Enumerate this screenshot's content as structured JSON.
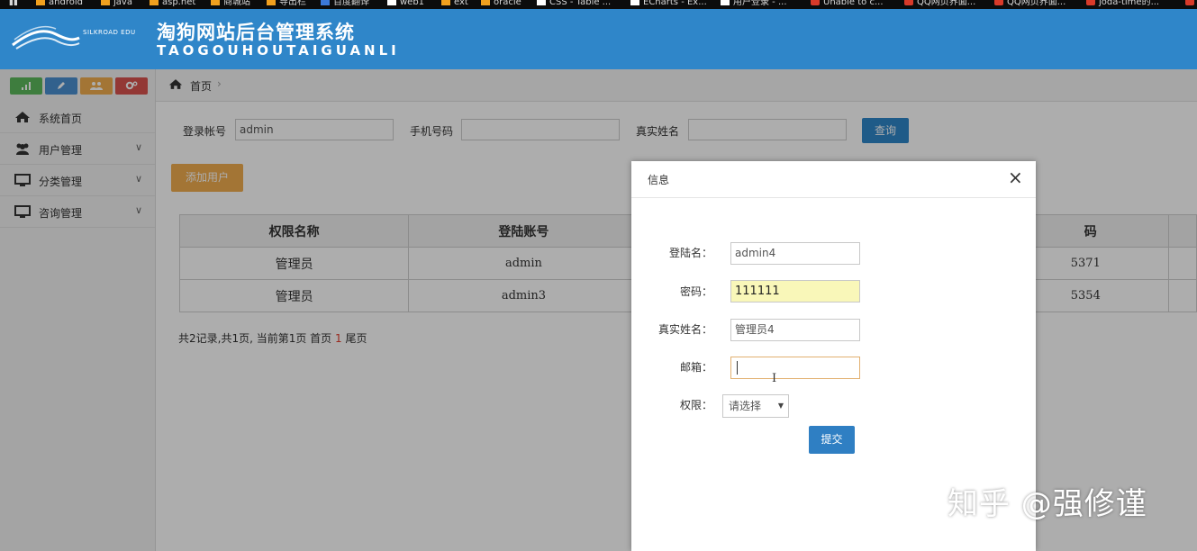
{
  "bookmarks": [
    {
      "label": "android",
      "icon": "folder-icon"
    },
    {
      "label": "java",
      "icon": "folder-icon"
    },
    {
      "label": "asp.net",
      "icon": "folder-icon"
    },
    {
      "label": "商城站",
      "icon": "folder-icon"
    },
    {
      "label": "导出栏",
      "icon": "folder-icon"
    },
    {
      "label": "百度翻译",
      "icon": "translate-icon"
    },
    {
      "label": "web1",
      "icon": "page-icon"
    },
    {
      "label": "ext",
      "icon": "folder-icon"
    },
    {
      "label": "oracle",
      "icon": "folder-icon"
    },
    {
      "label": "CSS - Table ...",
      "icon": "page-icon"
    },
    {
      "label": "ECharts - Ex...",
      "icon": "page-icon"
    },
    {
      "label": "用户登录 - ...",
      "icon": "page-icon"
    },
    {
      "label": "Unable to c...",
      "icon": "red-page-icon"
    },
    {
      "label": "QQ网页界面...",
      "icon": "red-page-icon"
    },
    {
      "label": "QQ网页界面...",
      "icon": "red-page-icon"
    },
    {
      "label": "joda-time的...",
      "icon": "red-page-icon"
    }
  ],
  "header": {
    "logo_text": "SILKROAD EDU",
    "title": "淘狗网站后台管理系统",
    "subtitle": "TAOGOUHOUTAIGUANLI",
    "color": "#2f86c9"
  },
  "sidebar": {
    "buttons": [
      {
        "icon": "signal-icon",
        "color": "#5cb85c"
      },
      {
        "icon": "pencil-icon",
        "color": "#4a90d0"
      },
      {
        "icon": "users-icon",
        "color": "#f0ad4e"
      },
      {
        "icon": "cogs-icon",
        "color": "#d9534f"
      }
    ],
    "items": [
      {
        "label": "系统首页",
        "icon": "home-icon",
        "expandable": false
      },
      {
        "label": "用户管理",
        "icon": "users-icon",
        "expandable": true
      },
      {
        "label": "分类管理",
        "icon": "monitor-icon",
        "expandable": true
      },
      {
        "label": "咨询管理",
        "icon": "monitor-icon",
        "expandable": true
      }
    ]
  },
  "breadcrumb": {
    "home": "首页",
    "separator": "›"
  },
  "search": {
    "account_label": "登录帐号",
    "account_value": "admin",
    "phone_label": "手机号码",
    "phone_value": "",
    "realname_label": "真实姓名",
    "realname_value": "",
    "button": "查询"
  },
  "add_button": "添加用户",
  "table": {
    "headers": [
      "权限名称",
      "登陆账号",
      "",
      "码",
      ""
    ],
    "rows": [
      [
        "管理员",
        "admin",
        "",
        "5371",
        ""
      ],
      [
        "管理员",
        "admin3",
        "",
        "5354",
        ""
      ]
    ]
  },
  "pager": {
    "before": "共2记录,共1页, 当前第1页 首页 ",
    "current": "1",
    "after": " 尾页"
  },
  "modal": {
    "title": "信息",
    "close": "×",
    "fields": {
      "login_name": {
        "label": "登陆名：",
        "value": "admin4"
      },
      "password": {
        "label": "密码：",
        "value": "111111"
      },
      "real_name": {
        "label": "真实姓名：",
        "value": "管理员4"
      },
      "email": {
        "label": "邮箱：",
        "value": ""
      },
      "role": {
        "label": "权限：",
        "selected": "请选择"
      }
    },
    "submit": "提交",
    "cursor_glyph": "I"
  },
  "watermark": "知乎 @强修谨"
}
